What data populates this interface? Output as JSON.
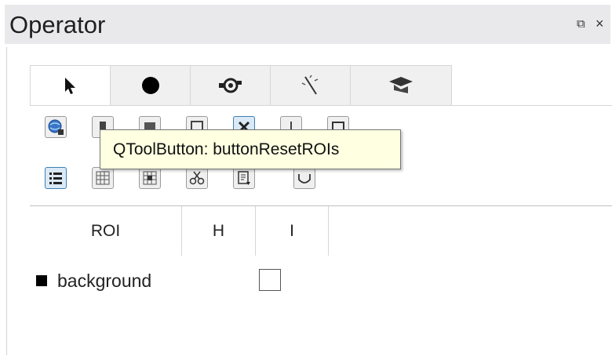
{
  "window": {
    "title": "Operator"
  },
  "tabs": [
    {
      "icon": "pointer-arrow-icon"
    },
    {
      "icon": "circle-icon"
    },
    {
      "icon": "camera-icon"
    },
    {
      "icon": "magic-wand-icon"
    },
    {
      "icon": "graduation-cap-icon"
    }
  ],
  "toolbar": {
    "row1": [
      "globe-add-icon",
      "tool-2-icon",
      "tool-3-icon",
      "tool-4-icon",
      "reset-rois-icon",
      "tool-6-icon",
      "tool-7-icon"
    ],
    "row2": [
      "list-checked-icon",
      "grid-icon",
      "grid-add-icon",
      "scissors-icon",
      "document-export-icon",
      "shape-icon"
    ]
  },
  "tooltip": {
    "text": "QToolButton: buttonResetROIs"
  },
  "table": {
    "columns": [
      "ROI",
      "H",
      "I"
    ],
    "rows": [
      {
        "label": "background",
        "checked": false
      }
    ]
  }
}
